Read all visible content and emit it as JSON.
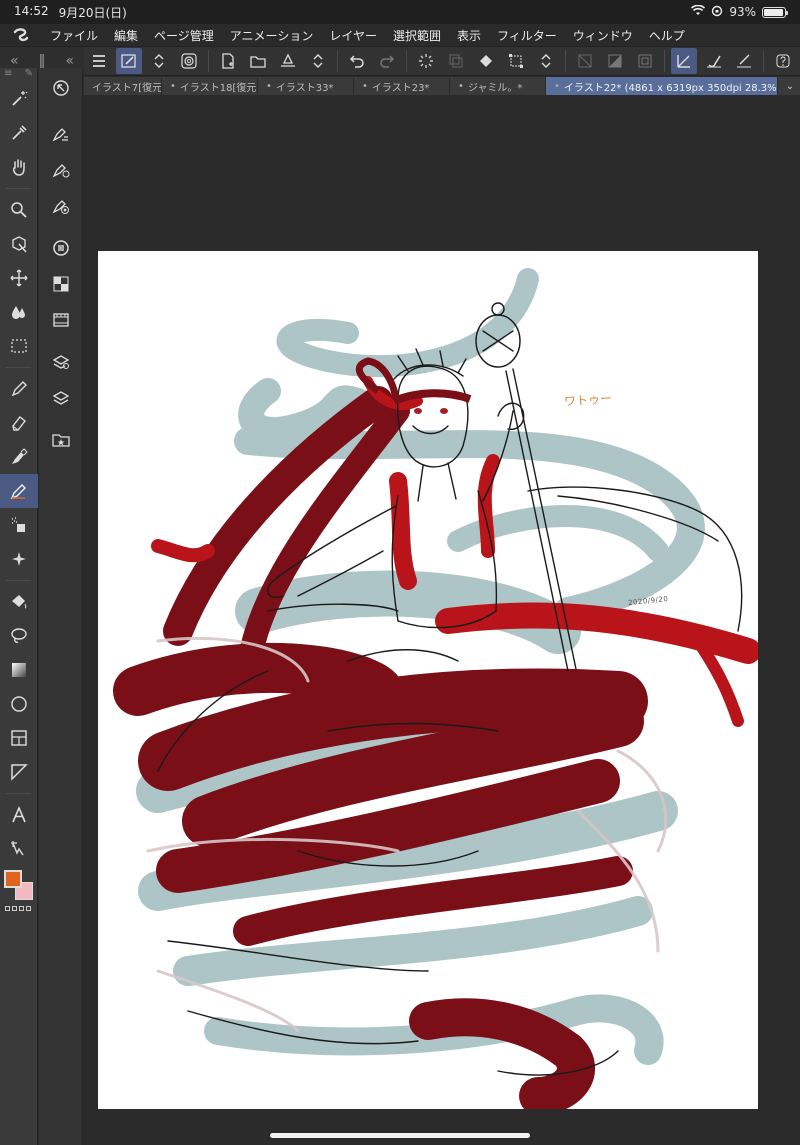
{
  "status_bar": {
    "time": "14:52",
    "date": "9月20日(日)",
    "battery": "93%",
    "battery_level": 0.93
  },
  "menu": {
    "items": [
      "ファイル",
      "編集",
      "ページ管理",
      "アニメーション",
      "レイヤー",
      "選択範囲",
      "表示",
      "フィルター",
      "ウィンドウ",
      "ヘルプ"
    ]
  },
  "tabs": [
    {
      "label": "イラスト7[復元"
    },
    {
      "label": "イラスト18[復元"
    },
    {
      "label": "イラスト33*"
    },
    {
      "label": "イラスト23*"
    },
    {
      "label": "ジャミル。*"
    },
    {
      "label": "イラスト22* (4861 x 6319px 350dpi 28.3%)",
      "active": true
    }
  ],
  "canvas": {
    "signature_text": "ワトゥー",
    "date_text": "2020/9/20"
  },
  "colors": {
    "main": "#e0641e",
    "sub": "#f2b9c0",
    "accent": "#4a5a82",
    "dark_red": "#7a0f17",
    "red": "#b8141a",
    "teal_grey": "#a9c2c4"
  }
}
